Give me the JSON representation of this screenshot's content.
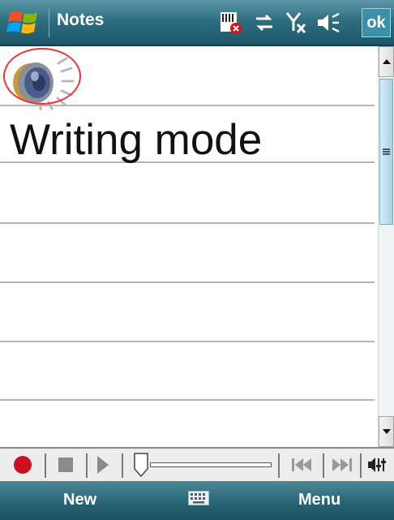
{
  "title_bar": {
    "title": "Notes",
    "ok_label": "ok",
    "icons": [
      "windows-start-icon",
      "storage-card-error-icon",
      "sync-arrows-icon",
      "no-signal-icon",
      "speaker-volume-icon"
    ]
  },
  "note": {
    "audio_icon": "speaker-icon",
    "text": "Writing mode"
  },
  "recording_toolbar": {
    "icons": [
      "record-icon",
      "stop-icon",
      "play-icon",
      "position-slider",
      "skip-back-icon",
      "skip-forward-icon",
      "volume-icon"
    ],
    "playback_position": 0
  },
  "softkeys": {
    "left_label": "New",
    "right_label": "Menu",
    "center_icon": "keyboard-icon"
  },
  "colors": {
    "title_bar": "#2f6f82",
    "softkey_bar": "#2b6878",
    "record_red": "#cc1020",
    "highlight_circle": "#e33333"
  }
}
